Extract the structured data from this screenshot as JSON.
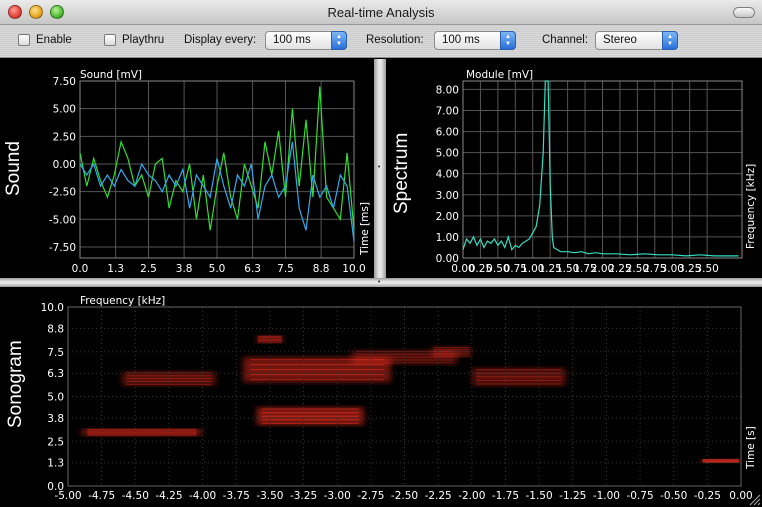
{
  "window": {
    "title": "Real-time Analysis"
  },
  "toolbar": {
    "enable_label": "Enable",
    "playthru_label": "Playthru",
    "display_every_label": "Display every:",
    "display_every_value": "100 ms",
    "resolution_label": "Resolution:",
    "resolution_value": "100 ms",
    "channel_label": "Channel:",
    "channel_value": "Stereo"
  },
  "panels": {
    "sound_label": "Sound",
    "spectrum_label": "Spectrum",
    "sonogram_label": "Sonogram"
  },
  "colors": {
    "series_green": "#33dd33",
    "series_blue": "#33aaee",
    "spectrum": "#33e0c0",
    "sonogram_hot": "#ff3322"
  },
  "chart_data": [
    {
      "type": "line",
      "name": "sound",
      "ylabel": "Sound [mV]",
      "xlabel": "Time [ms]",
      "xlim": [
        0,
        10
      ],
      "ylim": [
        -8.5,
        7.5
      ],
      "x_ticks": [
        "0.0",
        "1.3",
        "2.5",
        "3.8",
        "5.0",
        "6.3",
        "7.5",
        "8.8",
        "10.0"
      ],
      "y_ticks": [
        "7.50",
        "5.00",
        "2.50",
        "0.00",
        "-2.50",
        "-5.00",
        "-7.50"
      ],
      "x": [
        0,
        0.25,
        0.5,
        0.75,
        1,
        1.25,
        1.5,
        1.75,
        2,
        2.25,
        2.5,
        2.75,
        3,
        3.25,
        3.5,
        3.75,
        4,
        4.25,
        4.5,
        4.75,
        5,
        5.25,
        5.5,
        5.75,
        6,
        6.25,
        6.5,
        6.75,
        7,
        7.25,
        7.5,
        7.75,
        8,
        8.25,
        8.5,
        8.75,
        9,
        9.25,
        9.5,
        9.75,
        10
      ],
      "series": [
        {
          "color": "#33dd33",
          "values": [
            1,
            -2,
            0.5,
            -1.5,
            -3,
            -1,
            2,
            0.5,
            -2,
            -1,
            -3,
            0,
            0.5,
            -4,
            -1.5,
            -2.5,
            0,
            -5,
            -1,
            -6,
            -2,
            1,
            -3,
            -5,
            0,
            -2,
            -4,
            2,
            -1,
            3,
            -3,
            5,
            -2,
            4,
            -3,
            7,
            -3,
            -4,
            -5,
            1,
            -6
          ]
        },
        {
          "color": "#33aaee",
          "values": [
            0,
            -1,
            0,
            -2,
            -1,
            -2,
            -0.5,
            -1.5,
            -2,
            0,
            -1,
            -1.5,
            -2.5,
            -1,
            -2,
            -0.5,
            -4,
            -1,
            -2,
            -3,
            0.5,
            -2,
            -4,
            -1,
            -2,
            0,
            -5,
            -2,
            -1,
            -3,
            -2,
            2,
            -4,
            -6,
            -1,
            -3,
            -2,
            -4,
            -1,
            -2,
            -7
          ]
        }
      ]
    },
    {
      "type": "line",
      "name": "spectrum",
      "ylabel": "Module [mV]",
      "xlabel": "Frequency [kHz]",
      "xlim": [
        0,
        4
      ],
      "ylim": [
        0,
        8.4
      ],
      "x_ticks": [
        "0.00",
        "0.25",
        "0.50",
        "0.75",
        "1.00",
        "1.25",
        "1.50",
        "1.75",
        "2.00",
        "2.25",
        "2.50",
        "2.75",
        "3.00",
        "3.25",
        "3.50"
      ],
      "y_ticks": [
        "8.00",
        "7.00",
        "6.00",
        "5.00",
        "4.00",
        "3.00",
        "2.00",
        "1.00",
        "0.00"
      ],
      "x": [
        0,
        0.05,
        0.1,
        0.15,
        0.2,
        0.25,
        0.3,
        0.35,
        0.4,
        0.45,
        0.5,
        0.55,
        0.6,
        0.65,
        0.7,
        0.75,
        0.8,
        0.85,
        0.9,
        0.95,
        1,
        1.05,
        1.1,
        1.15,
        1.18,
        1.2,
        1.22,
        1.25,
        1.28,
        1.3,
        1.35,
        1.4,
        1.5,
        1.6,
        1.7,
        1.8,
        1.9,
        2,
        2.2,
        2.4,
        2.6,
        2.8,
        3,
        3.2,
        3.4,
        3.6,
        3.8,
        3.95
      ],
      "series": [
        {
          "color": "#33e0c0",
          "values": [
            0.4,
            0.9,
            0.7,
            1.0,
            0.6,
            0.9,
            0.5,
            0.8,
            0.7,
            0.9,
            0.6,
            0.8,
            0.5,
            1.0,
            0.4,
            0.6,
            0.5,
            0.7,
            0.8,
            0.9,
            1.2,
            1.5,
            2.5,
            5.0,
            8.4,
            8.4,
            8.4,
            3.5,
            1.0,
            0.5,
            0.4,
            0.3,
            0.3,
            0.25,
            0.3,
            0.2,
            0.25,
            0.2,
            0.2,
            0.15,
            0.2,
            0.15,
            0.15,
            0.1,
            0.15,
            0.1,
            0.1,
            0.1
          ]
        }
      ]
    },
    {
      "type": "heatmap",
      "name": "sonogram",
      "ylabel": "Frequency [kHz]",
      "xlabel": "Time [s]",
      "xlim": [
        -5,
        0
      ],
      "ylim": [
        0,
        10
      ],
      "x_ticks": [
        "-5.00",
        "-4.75",
        "-4.50",
        "-4.25",
        "-4.00",
        "-3.75",
        "-3.50",
        "-3.25",
        "-3.00",
        "-2.75",
        "-2.50",
        "-2.25",
        "-2.00",
        "-1.75",
        "-1.50",
        "-1.25",
        "-1.00",
        "-0.75",
        "-0.50",
        "-0.25",
        "0.00"
      ],
      "y_ticks": [
        "10.0",
        "8.8",
        "7.5",
        "6.3",
        "5.0",
        "3.8",
        "2.5",
        "1.3",
        "0.0"
      ],
      "blobs": [
        {
          "t0": -4.9,
          "t1": -4.0,
          "f0": 2.8,
          "f1": 3.2,
          "intensity": 0.8
        },
        {
          "t0": -4.6,
          "t1": -3.9,
          "f0": 5.6,
          "f1": 6.4,
          "intensity": 0.6
        },
        {
          "t0": -3.6,
          "t1": -2.8,
          "f0": 3.4,
          "f1": 4.4,
          "intensity": 0.9
        },
        {
          "t0": -3.7,
          "t1": -2.6,
          "f0": 5.8,
          "f1": 7.2,
          "intensity": 0.8
        },
        {
          "t0": -3.6,
          "t1": -3.4,
          "f0": 8.0,
          "f1": 8.4,
          "intensity": 0.7
        },
        {
          "t0": -2.9,
          "t1": -2.1,
          "f0": 6.8,
          "f1": 7.6,
          "intensity": 0.5
        },
        {
          "t0": -2.0,
          "t1": -1.3,
          "f0": 5.6,
          "f1": 6.6,
          "intensity": 0.6
        },
        {
          "t0": -2.3,
          "t1": -2.0,
          "f0": 7.2,
          "f1": 7.8,
          "intensity": 0.5
        },
        {
          "t0": -0.3,
          "t1": 0.0,
          "f0": 1.3,
          "f1": 1.5,
          "intensity": 0.9
        }
      ]
    }
  ]
}
